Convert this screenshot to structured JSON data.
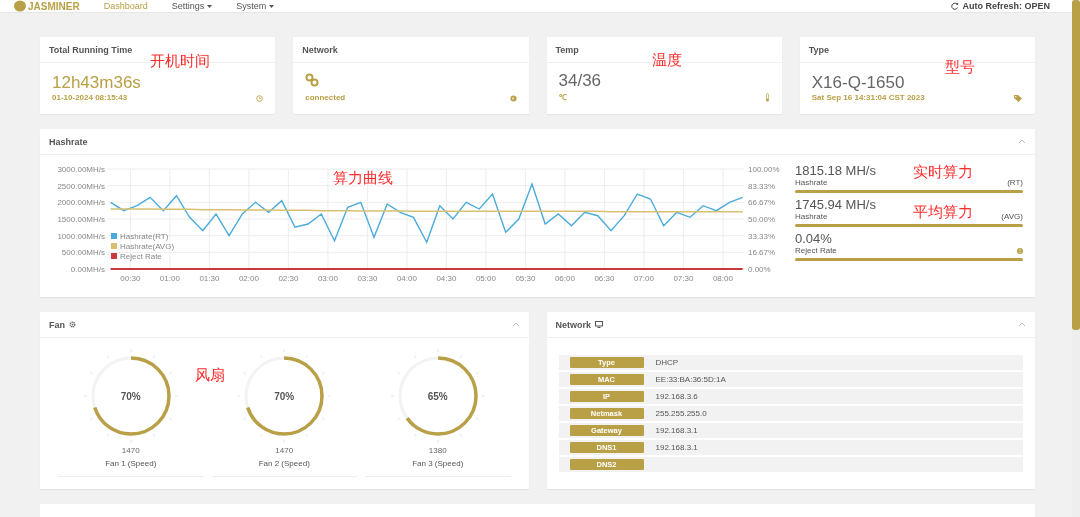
{
  "nav": {
    "logo": "JASMINER",
    "items": [
      {
        "label": "Dashboard",
        "selected": true,
        "dropdown": false
      },
      {
        "label": "Settings",
        "selected": false,
        "dropdown": true
      },
      {
        "label": "System",
        "selected": false,
        "dropdown": true
      }
    ],
    "auto_refresh": "Auto Refresh: OPEN"
  },
  "cards": [
    {
      "kind": "time",
      "title": "Total Running Time",
      "value": "12h43m36s",
      "sub": "01-10-2024 08:15:43",
      "annotation": "开机时间"
    },
    {
      "kind": "network",
      "title": "Network",
      "sub": "connected"
    },
    {
      "kind": "temp",
      "title": "Temp",
      "value": "34/36",
      "sub": "℃",
      "annotation": "温度"
    },
    {
      "kind": "type",
      "title": "Type",
      "value": "X16-Q-1650",
      "sub": "Sat Sep 16 14:31:04 CST 2023",
      "annotation": "型号"
    }
  ],
  "hashrate": {
    "title": "Hashrate",
    "annotation": "算力曲线",
    "chart_data": {
      "type": "line",
      "x": [
        15,
        25,
        35,
        45,
        55,
        65,
        75,
        85,
        95,
        105,
        115,
        125,
        135,
        145,
        155,
        165,
        175,
        185,
        195,
        205,
        215,
        225,
        235,
        245,
        255,
        265,
        275,
        285,
        295,
        305,
        315,
        325,
        335,
        345,
        355,
        365,
        375,
        385,
        395,
        405,
        415,
        425,
        435,
        445,
        455,
        465,
        475,
        485,
        495
      ],
      "xlim": [
        13,
        496
      ],
      "xticks": [
        {
          "value": 30,
          "label": "00:30"
        },
        {
          "value": 60,
          "label": "01:00"
        },
        {
          "value": 90,
          "label": "01:30"
        },
        {
          "value": 120,
          "label": "02:00"
        },
        {
          "value": 150,
          "label": "02:30"
        },
        {
          "value": 180,
          "label": "03:00"
        },
        {
          "value": 210,
          "label": "03:30"
        },
        {
          "value": 240,
          "label": "04:00"
        },
        {
          "value": 270,
          "label": "04:30"
        },
        {
          "value": 300,
          "label": "05:00"
        },
        {
          "value": 330,
          "label": "05:30"
        },
        {
          "value": 360,
          "label": "06:00"
        },
        {
          "value": 390,
          "label": "06:30"
        },
        {
          "value": 420,
          "label": "07:00"
        },
        {
          "value": 450,
          "label": "07:30"
        },
        {
          "value": 480,
          "label": "08:00"
        }
      ],
      "ylim": [
        0,
        3000
      ],
      "grid": true,
      "legend": true,
      "yticks": [
        {
          "value": 0,
          "label": "0.00MH/s"
        },
        {
          "value": 500,
          "label": "500.00MH/s"
        },
        {
          "value": 1000,
          "label": "1000.00MH/s"
        },
        {
          "value": 1500,
          "label": "1500.00MH/s"
        },
        {
          "value": 2000,
          "label": "2000.00MH/s"
        },
        {
          "value": 2500,
          "label": "2500.00MH/s"
        },
        {
          "value": 3000,
          "label": "3000.00MH/s"
        }
      ],
      "series": [
        {
          "name": "Hashrate(RT)",
          "color": "#4aabdb",
          "values": [
            2000,
            1750,
            1900,
            2150,
            1750,
            2200,
            1550,
            1150,
            1650,
            1000,
            1650,
            2000,
            1700,
            2050,
            1250,
            1350,
            1650,
            850,
            1850,
            2000,
            950,
            1950,
            1700,
            1550,
            800,
            1900,
            1500,
            2000,
            1800,
            2250,
            1100,
            1500,
            2550,
            1350,
            1650,
            1300,
            1700,
            1600,
            1150,
            1600,
            2250,
            2100,
            1300,
            1700,
            1550,
            1900,
            1750,
            2000,
            2150
          ]
        },
        {
          "name": "Hashrate(AVG)",
          "color": "#d9c070",
          "values": [
            1800,
            1800,
            1800,
            1800,
            1790,
            1790,
            1790,
            1780,
            1780,
            1780,
            1770,
            1770,
            1770,
            1760,
            1760,
            1760,
            1750,
            1750,
            1750,
            1740,
            1740,
            1740,
            1740,
            1730,
            1730,
            1730,
            1730,
            1730,
            1730,
            1730,
            1730,
            1730,
            1730,
            1730,
            1730,
            1730,
            1730,
            1730,
            1720,
            1720,
            1720,
            1720,
            1720,
            1720,
            1720,
            1720,
            1720,
            1720,
            1720
          ]
        },
        {
          "name": "Reject Rate",
          "color": "#c9383a",
          "values": [
            0,
            0,
            0,
            0,
            0,
            0,
            0,
            0,
            0,
            0,
            0,
            0,
            0,
            0,
            0,
            0,
            0,
            0,
            0,
            0,
            0,
            0,
            0,
            0,
            0,
            0,
            0,
            0,
            0,
            0,
            0,
            0,
            0,
            0,
            0,
            0,
            0,
            0,
            0,
            0,
            0,
            0,
            0,
            0,
            0,
            0,
            0,
            0,
            0
          ]
        }
      ]
    },
    "y2ticks": [
      "100.00%",
      "83.33%",
      "66.67%",
      "50.00%",
      "33.33%",
      "16.67%",
      "0.00%"
    ],
    "stats": [
      {
        "value": "1815.18 MH/s",
        "label": "Hashrate",
        "tag": "(RT)",
        "annotation": "实时算力"
      },
      {
        "value": "1745.94 MH/s",
        "label": "Hashrate",
        "tag": "(AVG)",
        "annotation": "平均算力"
      },
      {
        "value": "0.04%",
        "label": "Reject Rate",
        "warning": true
      }
    ]
  },
  "fan": {
    "title": "Fan",
    "annotation": "风扇",
    "fans": [
      {
        "percent": "70%",
        "level": 0.7,
        "rpm": "1470",
        "label": "Fan 1 (Speed)"
      },
      {
        "percent": "70%",
        "level": 0.7,
        "rpm": "1470",
        "label": "Fan 2 (Speed)"
      },
      {
        "percent": "65%",
        "level": 0.65,
        "rpm": "1380",
        "label": "Fan 3 (Speed)"
      }
    ]
  },
  "network": {
    "title": "Network",
    "rows": [
      {
        "label": "Type",
        "value": "DHCP"
      },
      {
        "label": "MAC",
        "value": "EE:33:BA:36:5D:1A"
      },
      {
        "label": "IP",
        "value": "192.168.3.6"
      },
      {
        "label": "Netmask",
        "value": "255.255.255.0"
      },
      {
        "label": "Gateway",
        "value": "192.168.3.1"
      },
      {
        "label": "DNS1",
        "value": "192.168.3.1"
      },
      {
        "label": "DNS2"
      }
    ]
  }
}
